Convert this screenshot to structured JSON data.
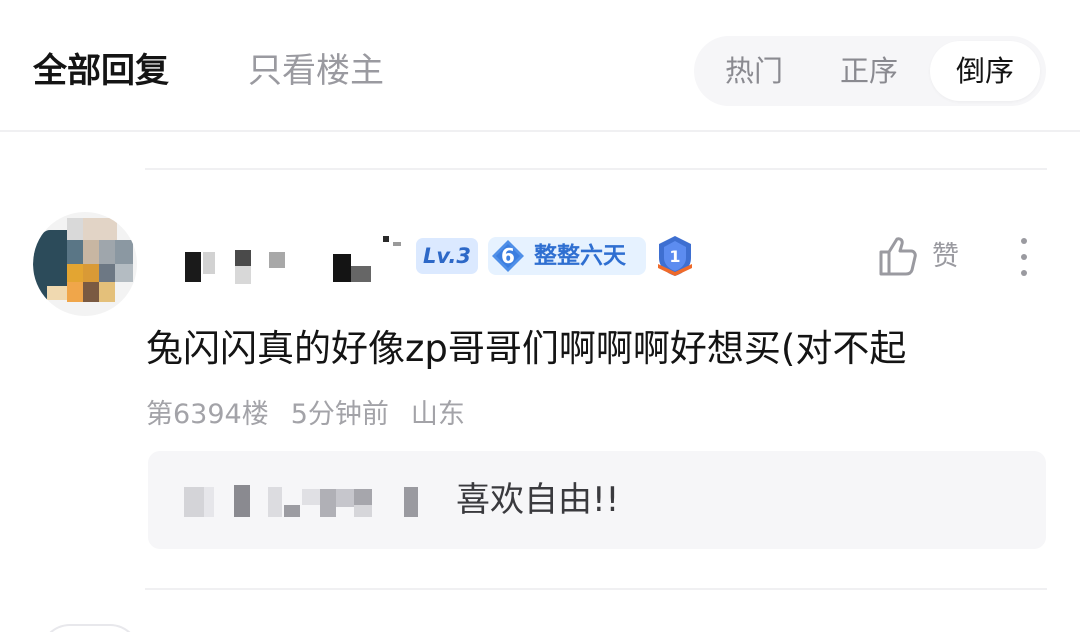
{
  "tabs": {
    "all": "全部回复",
    "owner_only": "只看楼主"
  },
  "sort": {
    "hot": "热门",
    "asc": "正序",
    "desc": "倒序",
    "selected": "倒序"
  },
  "comment": {
    "badges": {
      "level": "Lv.3",
      "days_num": "6",
      "days_text": "整整六天",
      "rank": "1"
    },
    "like_label": "赞",
    "text": "兔闪闪真的好像zp哥哥们啊啊啊好想买(对不起",
    "floor": "第6394楼",
    "time": "5分钟前",
    "location": "山东",
    "reply": {
      "text": "喜欢自由!!"
    }
  },
  "colors": {
    "accent_blue": "#2f6fd1",
    "badge_bg": "#dbe9ff",
    "muted_text": "#a3a3a8",
    "reply_bg": "#f6f6f8"
  },
  "icons": [
    "thumbs-up-icon",
    "more-vertical-icon",
    "rank-shield-icon",
    "days-diamond-icon"
  ]
}
